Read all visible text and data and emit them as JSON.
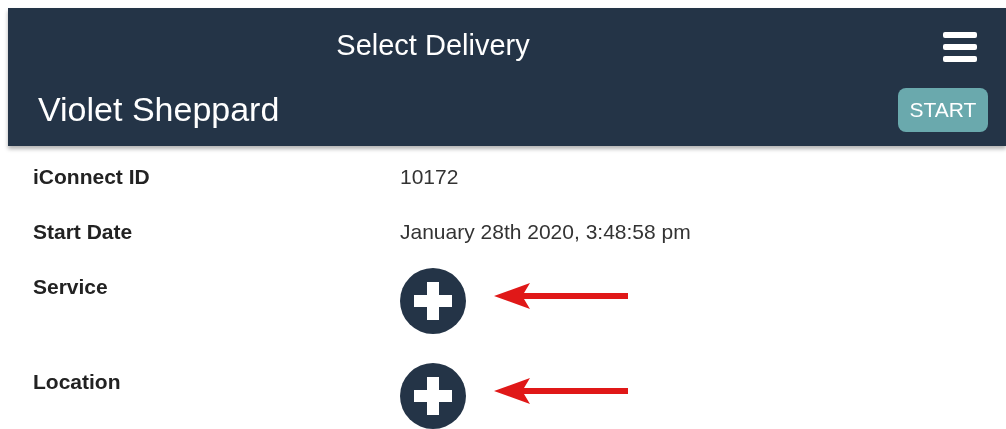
{
  "header": {
    "title": "Select Delivery",
    "name": "Violet Sheppard",
    "start_button": "START"
  },
  "fields": [
    {
      "label": "iConnect ID",
      "kind": "text",
      "value": "10172"
    },
    {
      "label": "Start Date",
      "kind": "text",
      "value": "January 28th 2020, 3:48:58 pm"
    },
    {
      "label": "Service",
      "kind": "add",
      "arrow": true
    },
    {
      "label": "Location",
      "kind": "add",
      "arrow": true
    }
  ]
}
